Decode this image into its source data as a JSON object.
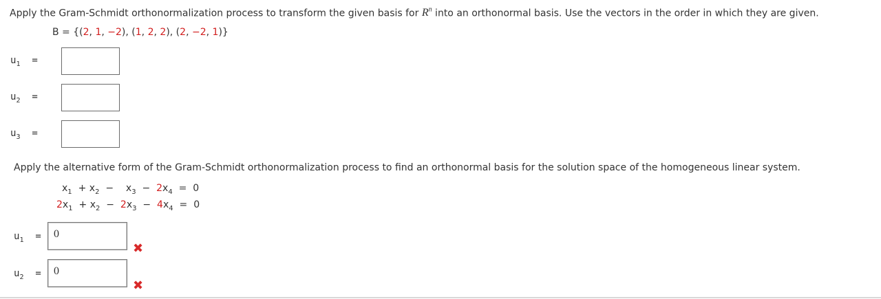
{
  "problem1": {
    "instruction_a": "Apply the Gram-Schmidt orthonormalization process to transform the given basis for ",
    "instruction_R": "R",
    "instruction_n": "n",
    "instruction_b": " into an orthonormal basis. Use the vectors in the order in which they are given.",
    "basis_prefix": "B = {(",
    "basis": [
      {
        "parts": [
          "2",
          "1",
          "−2"
        ]
      },
      {
        "parts": [
          "1",
          "2",
          "2"
        ]
      },
      {
        "parts": [
          "2",
          "−2",
          "1"
        ]
      }
    ],
    "labels": [
      "u",
      "u",
      "u"
    ],
    "subs": [
      "1",
      "2",
      "3"
    ],
    "equals": "="
  },
  "problem2": {
    "instruction": "Apply the alternative form of the Gram-Schmidt orthonormalization process to find an orthonormal basis for the solution space of the homogeneous linear system.",
    "system": {
      "row1": {
        "x1": "x",
        "s1": "1",
        "p1": "+",
        "x2": "x",
        "s2": "2",
        "m1": "−",
        "x3": "x",
        "s3": "3",
        "m2": "−",
        "c4": "2",
        "x4": "x",
        "s4": "4",
        "eq": "=",
        "rhs": "0"
      },
      "row2": {
        "c1": "2",
        "x1": "x",
        "s1": "1",
        "p1": "+",
        "x2": "x",
        "s2": "2",
        "m1": "−",
        "c3": "2",
        "x3": "x",
        "s3": "3",
        "m2": "−",
        "c4": "4",
        "x4": "x",
        "s4": "4",
        "eq": "=",
        "rhs": "0"
      }
    },
    "answers": [
      {
        "label": "u",
        "sub": "1",
        "value": "0",
        "status": "incorrect"
      },
      {
        "label": "u",
        "sub": "2",
        "value": "0",
        "status": "incorrect"
      }
    ],
    "equals": "=",
    "incorrect_mark": "✖"
  },
  "colors": {
    "accent_red": "#d21e1e",
    "wrong_mark": "#d82a2a"
  }
}
